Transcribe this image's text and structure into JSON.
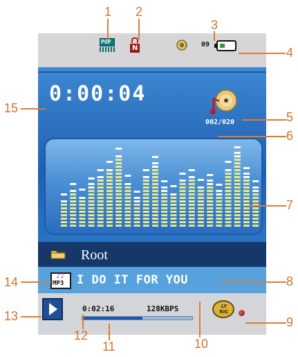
{
  "status": {
    "eq_preset_icon": "pop-eq-icon",
    "eq_preset_label": "POP",
    "repeat_icon": "repeat-normal-icon",
    "repeat_label": "N",
    "volume_icon": "speaker-icon",
    "volume_value": "09",
    "battery_icon": "battery-icon"
  },
  "display": {
    "time": "0:00:04",
    "track_counter": "002/020",
    "music_icon": "music-cd-icon",
    "equalizer_levels": [
      0.32,
      0.45,
      0.38,
      0.52,
      0.62,
      0.72,
      0.88,
      0.55,
      0.36,
      0.62,
      0.78,
      0.48,
      0.42,
      0.58,
      0.62,
      0.5,
      0.56,
      0.44,
      0.72,
      0.9,
      0.64,
      0.48
    ]
  },
  "folder": {
    "icon": "folder-icon",
    "label": "Root"
  },
  "song": {
    "format_icon": "mp3-file-icon",
    "format_label": "MP3",
    "title": "I DO IT FOR YOU"
  },
  "bottom": {
    "play_icon": "play-icon",
    "elapsed": "0:02:16",
    "bitrate": "128KBPS",
    "progress": 0.55,
    "lyric_icon": "lyric-icon",
    "lyric_label": "LY RIC",
    "record_icon": "record-dot-icon"
  },
  "callouts": [
    "1",
    "2",
    "3",
    "4",
    "5",
    "6",
    "7",
    "8",
    "9",
    "10",
    "11",
    "12",
    "13",
    "14",
    "15"
  ],
  "colors": {
    "panel_blue": "#2b6cc0",
    "callout_orange": "#e07b2f",
    "folder_bar": "#16376a",
    "song_bar": "#57a2dc"
  }
}
